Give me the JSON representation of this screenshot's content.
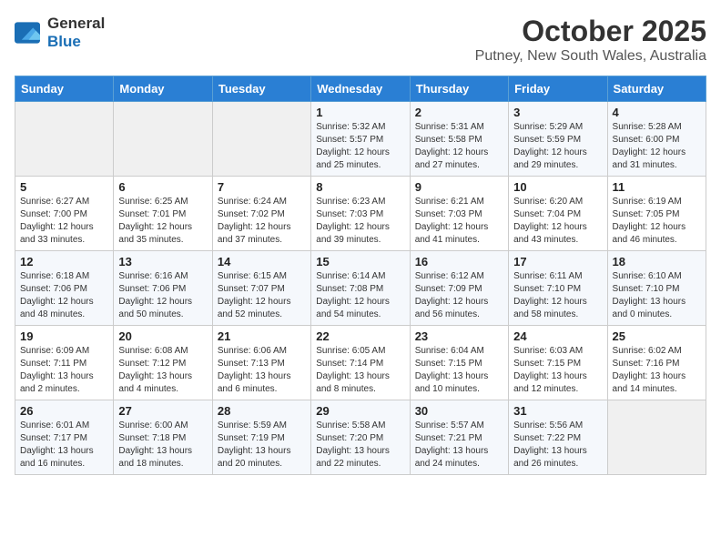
{
  "logo": {
    "line1": "General",
    "line2": "Blue"
  },
  "title": "October 2025",
  "subtitle": "Putney, New South Wales, Australia",
  "days_of_week": [
    "Sunday",
    "Monday",
    "Tuesday",
    "Wednesday",
    "Thursday",
    "Friday",
    "Saturday"
  ],
  "weeks": [
    [
      {
        "day": "",
        "info": ""
      },
      {
        "day": "",
        "info": ""
      },
      {
        "day": "",
        "info": ""
      },
      {
        "day": "1",
        "info": "Sunrise: 5:32 AM\nSunset: 5:57 PM\nDaylight: 12 hours\nand 25 minutes."
      },
      {
        "day": "2",
        "info": "Sunrise: 5:31 AM\nSunset: 5:58 PM\nDaylight: 12 hours\nand 27 minutes."
      },
      {
        "day": "3",
        "info": "Sunrise: 5:29 AM\nSunset: 5:59 PM\nDaylight: 12 hours\nand 29 minutes."
      },
      {
        "day": "4",
        "info": "Sunrise: 5:28 AM\nSunset: 6:00 PM\nDaylight: 12 hours\nand 31 minutes."
      }
    ],
    [
      {
        "day": "5",
        "info": "Sunrise: 6:27 AM\nSunset: 7:00 PM\nDaylight: 12 hours\nand 33 minutes."
      },
      {
        "day": "6",
        "info": "Sunrise: 6:25 AM\nSunset: 7:01 PM\nDaylight: 12 hours\nand 35 minutes."
      },
      {
        "day": "7",
        "info": "Sunrise: 6:24 AM\nSunset: 7:02 PM\nDaylight: 12 hours\nand 37 minutes."
      },
      {
        "day": "8",
        "info": "Sunrise: 6:23 AM\nSunset: 7:03 PM\nDaylight: 12 hours\nand 39 minutes."
      },
      {
        "day": "9",
        "info": "Sunrise: 6:21 AM\nSunset: 7:03 PM\nDaylight: 12 hours\nand 41 minutes."
      },
      {
        "day": "10",
        "info": "Sunrise: 6:20 AM\nSunset: 7:04 PM\nDaylight: 12 hours\nand 43 minutes."
      },
      {
        "day": "11",
        "info": "Sunrise: 6:19 AM\nSunset: 7:05 PM\nDaylight: 12 hours\nand 46 minutes."
      }
    ],
    [
      {
        "day": "12",
        "info": "Sunrise: 6:18 AM\nSunset: 7:06 PM\nDaylight: 12 hours\nand 48 minutes."
      },
      {
        "day": "13",
        "info": "Sunrise: 6:16 AM\nSunset: 7:06 PM\nDaylight: 12 hours\nand 50 minutes."
      },
      {
        "day": "14",
        "info": "Sunrise: 6:15 AM\nSunset: 7:07 PM\nDaylight: 12 hours\nand 52 minutes."
      },
      {
        "day": "15",
        "info": "Sunrise: 6:14 AM\nSunset: 7:08 PM\nDaylight: 12 hours\nand 54 minutes."
      },
      {
        "day": "16",
        "info": "Sunrise: 6:12 AM\nSunset: 7:09 PM\nDaylight: 12 hours\nand 56 minutes."
      },
      {
        "day": "17",
        "info": "Sunrise: 6:11 AM\nSunset: 7:10 PM\nDaylight: 12 hours\nand 58 minutes."
      },
      {
        "day": "18",
        "info": "Sunrise: 6:10 AM\nSunset: 7:10 PM\nDaylight: 13 hours\nand 0 minutes."
      }
    ],
    [
      {
        "day": "19",
        "info": "Sunrise: 6:09 AM\nSunset: 7:11 PM\nDaylight: 13 hours\nand 2 minutes."
      },
      {
        "day": "20",
        "info": "Sunrise: 6:08 AM\nSunset: 7:12 PM\nDaylight: 13 hours\nand 4 minutes."
      },
      {
        "day": "21",
        "info": "Sunrise: 6:06 AM\nSunset: 7:13 PM\nDaylight: 13 hours\nand 6 minutes."
      },
      {
        "day": "22",
        "info": "Sunrise: 6:05 AM\nSunset: 7:14 PM\nDaylight: 13 hours\nand 8 minutes."
      },
      {
        "day": "23",
        "info": "Sunrise: 6:04 AM\nSunset: 7:15 PM\nDaylight: 13 hours\nand 10 minutes."
      },
      {
        "day": "24",
        "info": "Sunrise: 6:03 AM\nSunset: 7:15 PM\nDaylight: 13 hours\nand 12 minutes."
      },
      {
        "day": "25",
        "info": "Sunrise: 6:02 AM\nSunset: 7:16 PM\nDaylight: 13 hours\nand 14 minutes."
      }
    ],
    [
      {
        "day": "26",
        "info": "Sunrise: 6:01 AM\nSunset: 7:17 PM\nDaylight: 13 hours\nand 16 minutes."
      },
      {
        "day": "27",
        "info": "Sunrise: 6:00 AM\nSunset: 7:18 PM\nDaylight: 13 hours\nand 18 minutes."
      },
      {
        "day": "28",
        "info": "Sunrise: 5:59 AM\nSunset: 7:19 PM\nDaylight: 13 hours\nand 20 minutes."
      },
      {
        "day": "29",
        "info": "Sunrise: 5:58 AM\nSunset: 7:20 PM\nDaylight: 13 hours\nand 22 minutes."
      },
      {
        "day": "30",
        "info": "Sunrise: 5:57 AM\nSunset: 7:21 PM\nDaylight: 13 hours\nand 24 minutes."
      },
      {
        "day": "31",
        "info": "Sunrise: 5:56 AM\nSunset: 7:22 PM\nDaylight: 13 hours\nand 26 minutes."
      },
      {
        "day": "",
        "info": ""
      }
    ]
  ]
}
